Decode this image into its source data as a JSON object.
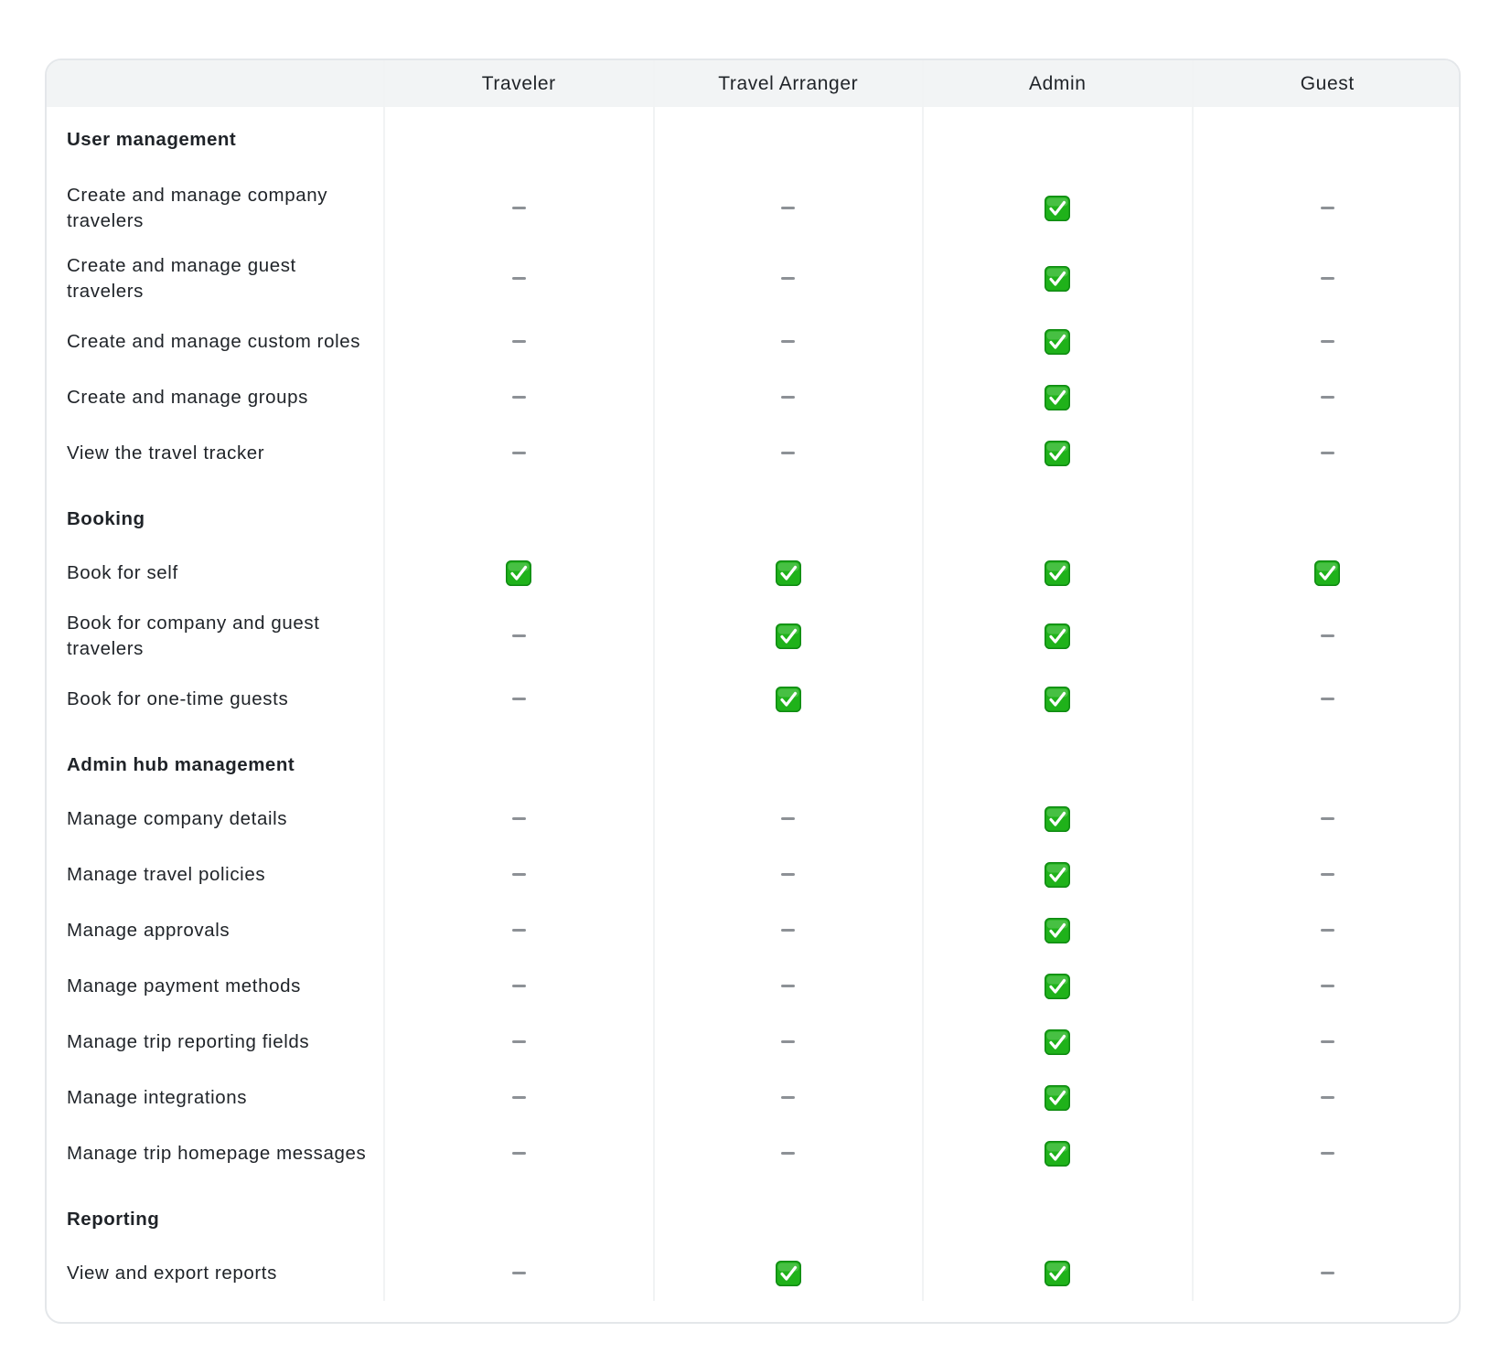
{
  "table": {
    "corner_label": "",
    "roles": [
      "Traveler",
      "Travel Arranger",
      "Admin",
      "Guest"
    ],
    "rows": [
      {
        "type": "section",
        "label": "User management"
      },
      {
        "type": "item",
        "label": "Create and manage company travelers",
        "values": [
          false,
          false,
          true,
          false
        ]
      },
      {
        "type": "item",
        "label": "Create and manage guest travelers",
        "values": [
          false,
          false,
          true,
          false
        ]
      },
      {
        "type": "item",
        "label": "Create and manage custom roles",
        "values": [
          false,
          false,
          true,
          false
        ]
      },
      {
        "type": "item",
        "label": "Create and manage groups",
        "values": [
          false,
          false,
          true,
          false
        ]
      },
      {
        "type": "item",
        "label": "View the travel tracker",
        "values": [
          false,
          false,
          true,
          false
        ]
      },
      {
        "type": "section",
        "label": "Booking"
      },
      {
        "type": "item",
        "label": "Book for self",
        "values": [
          true,
          true,
          true,
          true
        ]
      },
      {
        "type": "item",
        "label": "Book for company and guest travelers",
        "values": [
          false,
          true,
          true,
          false
        ]
      },
      {
        "type": "item",
        "label": "Book for one-time guests",
        "values": [
          false,
          true,
          true,
          false
        ]
      },
      {
        "type": "section",
        "label": "Admin hub management"
      },
      {
        "type": "item",
        "label": "Manage company details",
        "values": [
          false,
          false,
          true,
          false
        ]
      },
      {
        "type": "item",
        "label": "Manage travel policies",
        "values": [
          false,
          false,
          true,
          false
        ]
      },
      {
        "type": "item",
        "label": "Manage approvals",
        "values": [
          false,
          false,
          true,
          false
        ]
      },
      {
        "type": "item",
        "label": "Manage payment methods",
        "values": [
          false,
          false,
          true,
          false
        ]
      },
      {
        "type": "item",
        "label": "Manage trip reporting fields",
        "values": [
          false,
          false,
          true,
          false
        ]
      },
      {
        "type": "item",
        "label": "Manage integrations",
        "values": [
          false,
          false,
          true,
          false
        ]
      },
      {
        "type": "item",
        "label": "Manage trip homepage messages",
        "values": [
          false,
          false,
          true,
          false
        ]
      },
      {
        "type": "section",
        "label": "Reporting"
      },
      {
        "type": "item",
        "label": "View and export reports",
        "values": [
          false,
          true,
          true,
          false
        ]
      }
    ]
  },
  "icons": {
    "allowed": "green-check-icon",
    "not_allowed": "dash-icon"
  },
  "colors": {
    "check_green": "#1fb21a",
    "dash_gray": "#8d9196",
    "header_bg": "#f2f4f5",
    "border": "#e4e7ea"
  }
}
